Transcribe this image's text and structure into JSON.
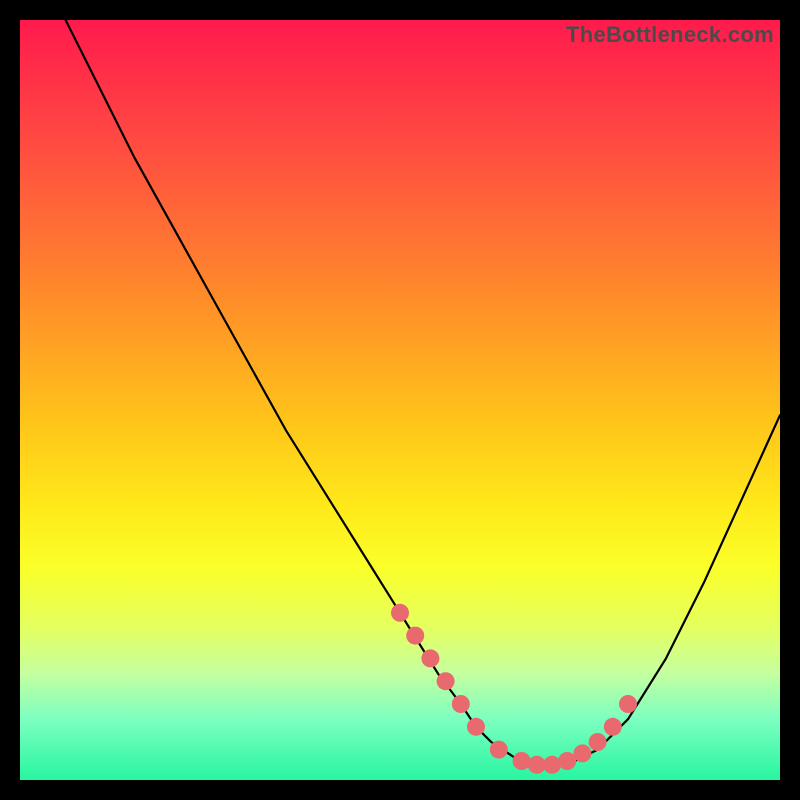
{
  "attribution": "TheBottleneck.com",
  "chart_data": {
    "type": "line",
    "title": "",
    "xlabel": "",
    "ylabel": "",
    "xlim": [
      0,
      100
    ],
    "ylim": [
      0,
      100
    ],
    "series": [
      {
        "name": "curve",
        "x": [
          6,
          10,
          15,
          20,
          25,
          30,
          35,
          40,
          45,
          50,
          55,
          58,
          60,
          62,
          65,
          68,
          70,
          73,
          76,
          80,
          85,
          90,
          95,
          100
        ],
        "values": [
          100,
          92,
          82,
          73,
          64,
          55,
          46,
          38,
          30,
          22,
          14,
          10,
          7,
          5,
          3,
          2,
          2,
          2.5,
          4,
          8,
          16,
          26,
          37,
          48
        ]
      }
    ],
    "markers": {
      "name": "highlighted-points",
      "color": "#e86a6f",
      "x": [
        50,
        52,
        54,
        56,
        58,
        60,
        63,
        66,
        68,
        70,
        72,
        74,
        76,
        78,
        80
      ],
      "values": [
        22,
        19,
        16,
        13,
        10,
        7,
        4,
        2.5,
        2,
        2,
        2.5,
        3.5,
        5,
        7,
        10
      ]
    },
    "background_gradient": {
      "top": "#ff1a4d",
      "mid": "#ffe91a",
      "bottom": "#28f5a0"
    }
  }
}
